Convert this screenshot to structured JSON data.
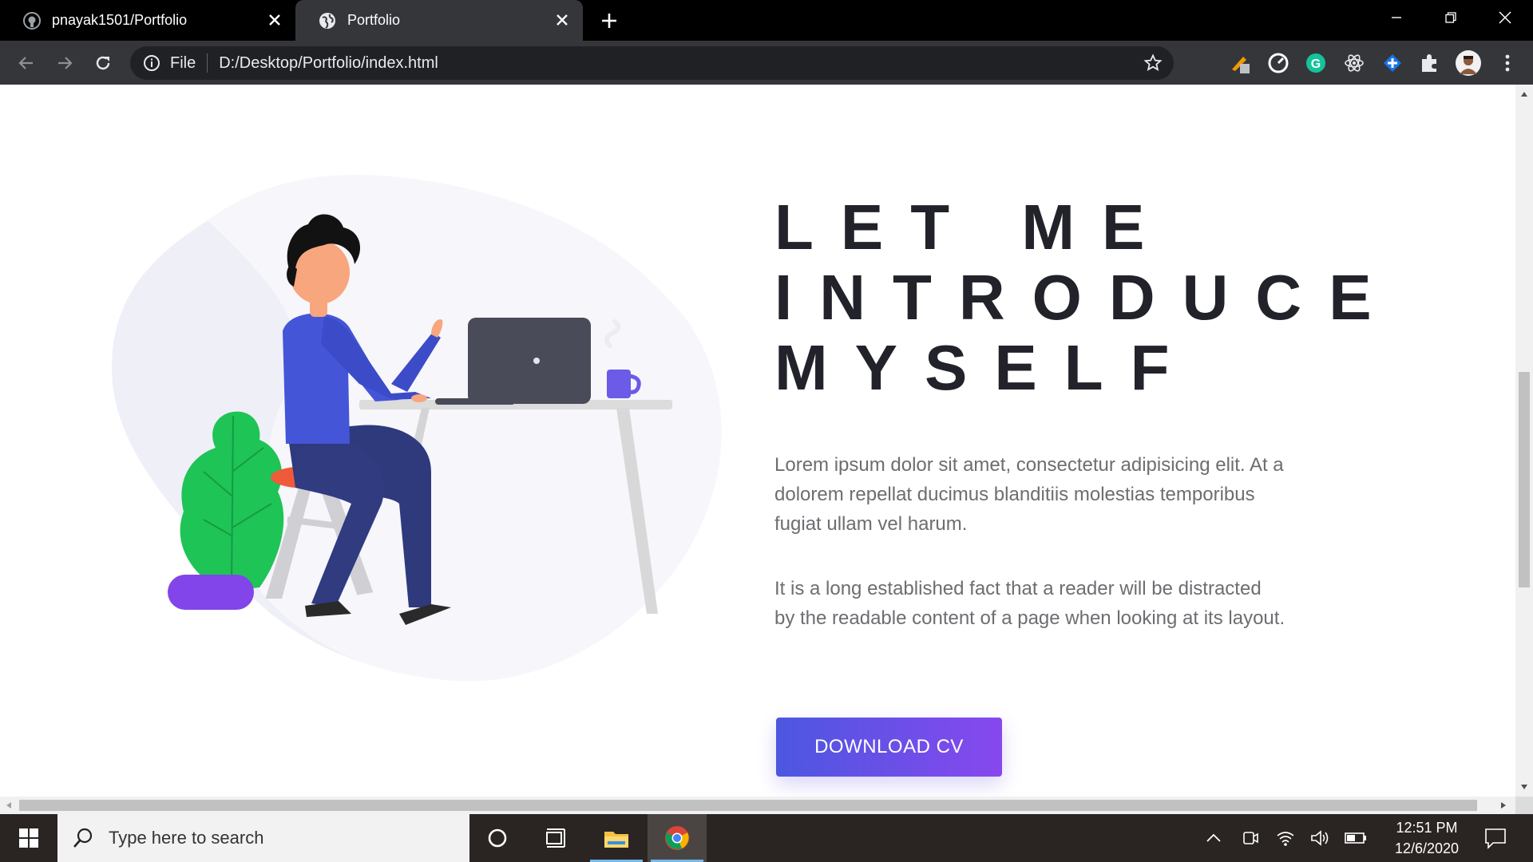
{
  "browser": {
    "tabs": [
      {
        "title": "pnayak1501/Portfolio",
        "icon": "github-icon",
        "active": false
      },
      {
        "title": "Portfolio",
        "icon": "globe-icon",
        "active": true
      }
    ],
    "address": {
      "scheme": "File",
      "url": "D:/Desktop/Portfolio/index.html"
    }
  },
  "page": {
    "headline": [
      "LET ME",
      "INTRODUCE",
      "MYSELF"
    ],
    "paragraphs": [
      "Lorem ipsum dolor sit amet, consectetur adipisicing elit. At a dolorem repellat ducimus blanditiis molestias temporibus fugiat ullam vel harum.",
      "It is a long established fact that a reader will be distracted by the readable content of a page when looking at its layout."
    ],
    "cta_label": "DOWNLOAD CV",
    "colors": {
      "accent_start": "#4c57e0",
      "accent_end": "#8748ee",
      "heading": "#22232a",
      "body_text": "#6d6d72"
    }
  },
  "taskbar": {
    "search_placeholder": "Type here to search",
    "time": "12:51 PM",
    "date": "12/6/2020",
    "pinned": [
      "cortana-icon",
      "task-view-icon",
      "file-explorer-icon",
      "chrome-icon"
    ]
  }
}
